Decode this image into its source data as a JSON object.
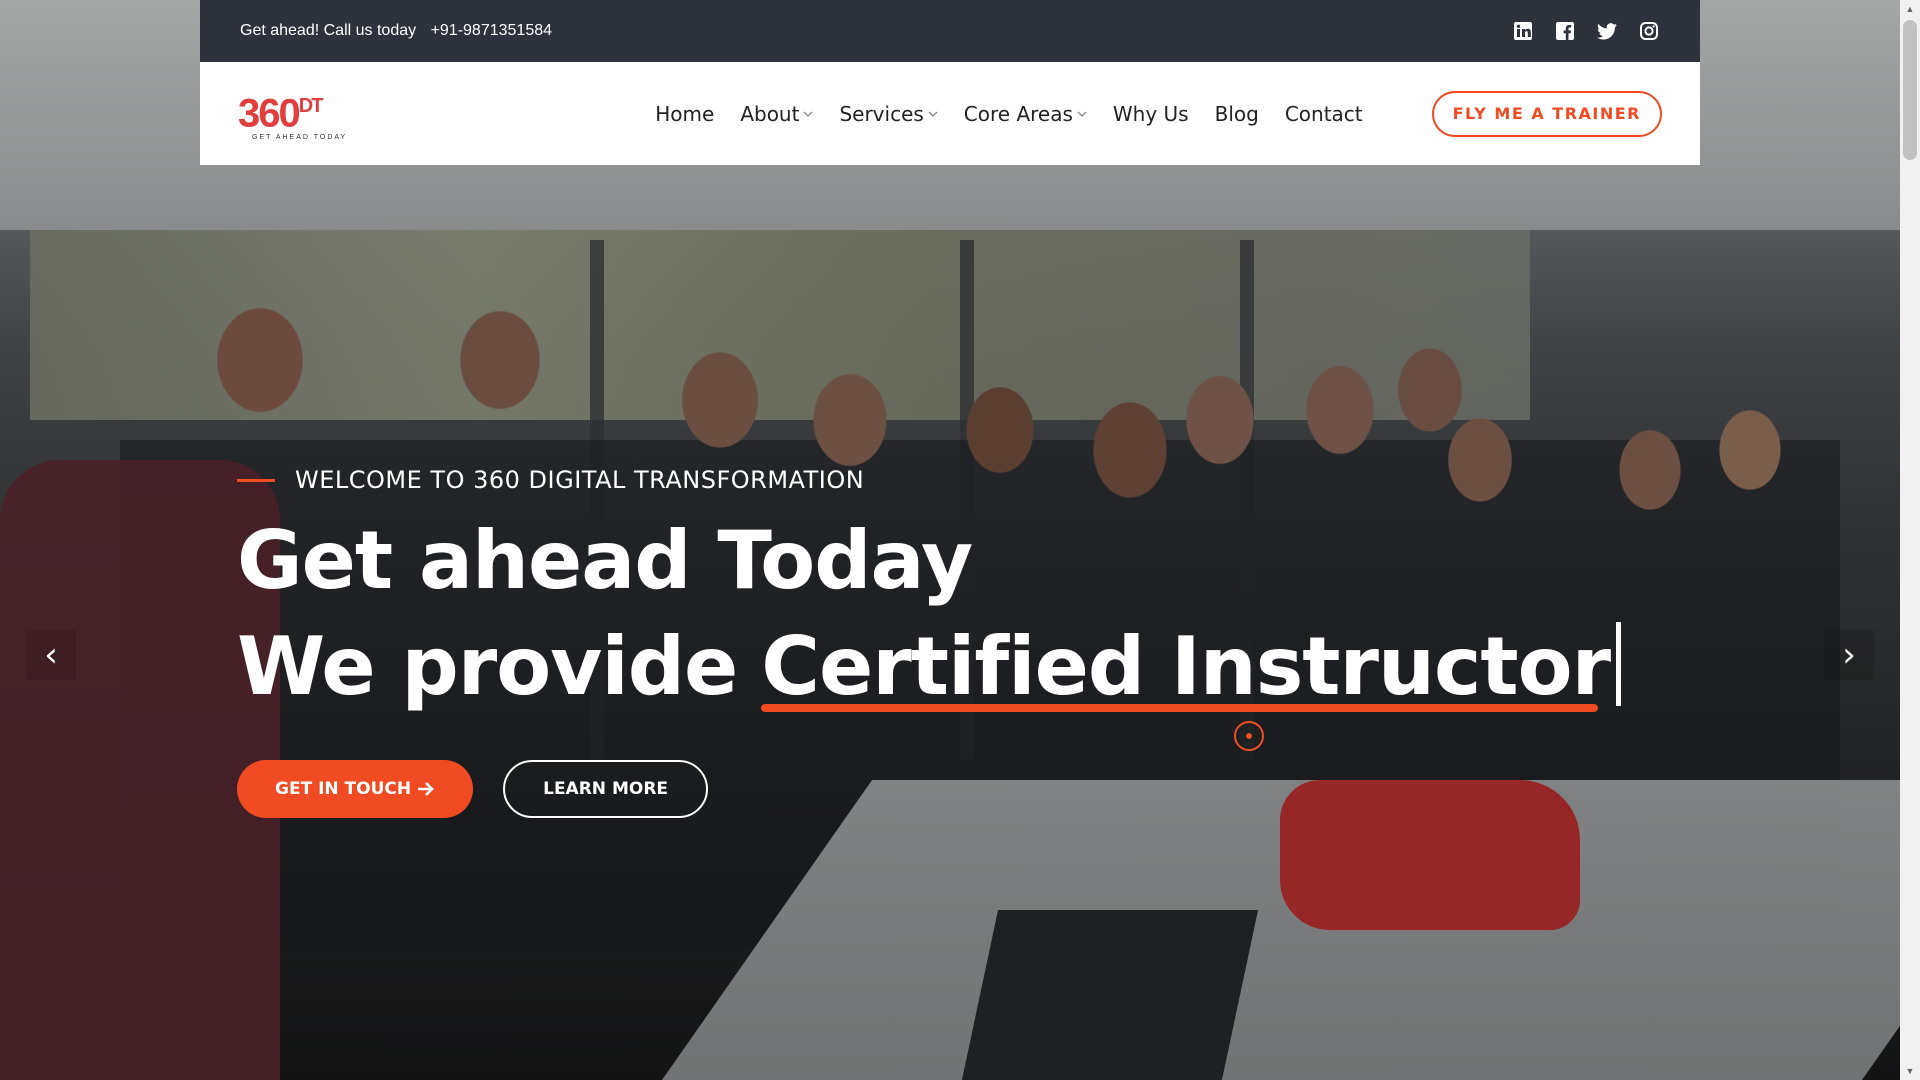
{
  "topbar": {
    "call_text": "Get ahead! Call us today",
    "phone": "+91-9871351584",
    "social_icons": [
      "linkedin-icon",
      "facebook-icon",
      "twitter-icon",
      "instagram-icon"
    ]
  },
  "logo": {
    "main": "360",
    "suffix": "DT",
    "tagline": "GET AHEAD TODAY"
  },
  "nav": {
    "items": [
      {
        "label": "Home",
        "dropdown": false
      },
      {
        "label": "About",
        "dropdown": true
      },
      {
        "label": "Services",
        "dropdown": true
      },
      {
        "label": "Core Areas",
        "dropdown": true
      },
      {
        "label": "Why Us",
        "dropdown": false
      },
      {
        "label": "Blog",
        "dropdown": false
      },
      {
        "label": "Contact",
        "dropdown": false
      }
    ],
    "cta": "FLY ME A TRAINER"
  },
  "hero": {
    "welcome": "WELCOME TO 360 DIGITAL TRANSFORMATION",
    "headline_line1": "Get ahead Today",
    "headline_line2_prefix": "We provide",
    "headline_line2_highlight": "Certified Instructor",
    "primary_button": "GET IN TOUCH",
    "secondary_button": "LEARN MORE",
    "prev_arrow": "‹",
    "next_arrow": "›"
  },
  "colors": {
    "accent": "#f04b23",
    "topbar_bg": "#2d323d",
    "logo_red": "#e23e3e"
  }
}
